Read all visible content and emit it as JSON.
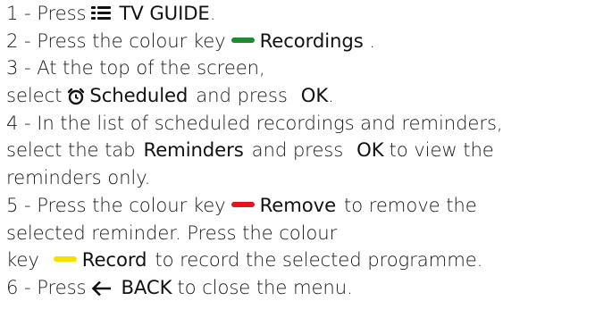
{
  "colors": {
    "green": "#1e8c2e",
    "red": "#e8141e",
    "yellow": "#f5e000"
  },
  "icons": {
    "tv_guide": "tv-guide-icon",
    "green_key": "green-colour-key-icon",
    "alarm": "alarm-clock-icon",
    "red_key": "red-colour-key-icon",
    "yellow_key": "yellow-colour-key-icon",
    "back": "back-arrow-icon"
  },
  "steps": {
    "s1": {
      "prefix": "1 -  Press",
      "button": "TV GUIDE",
      "suffix": "."
    },
    "s2": {
      "prefix": "2 -  Press the colour key",
      "button": "Recordings",
      "suffix": " ."
    },
    "s3": {
      "line1": "3 -  At the top of the screen,",
      "prefix": "select",
      "button": "Scheduled",
      "middle": "and press",
      "ok": "OK",
      "suffix": "."
    },
    "s4": {
      "line1": "4 -  In the list of scheduled recordings and reminders,",
      "prefix": "select the tab",
      "button": "Reminders",
      "middle": "and press",
      "ok": "OK",
      "rest": "to view the",
      "line3": "reminders only."
    },
    "s5": {
      "prefix": "5 -  Press the colour key",
      "button": "Remove",
      "rest": "to remove the",
      "line2": "selected reminder. Press the colour",
      "prefix3": "key",
      "button3": "Record",
      "rest3": "to record the selected programme."
    },
    "s6": {
      "prefix": "6 -  Press",
      "button": "BACK",
      "suffix": "to close the menu."
    }
  }
}
